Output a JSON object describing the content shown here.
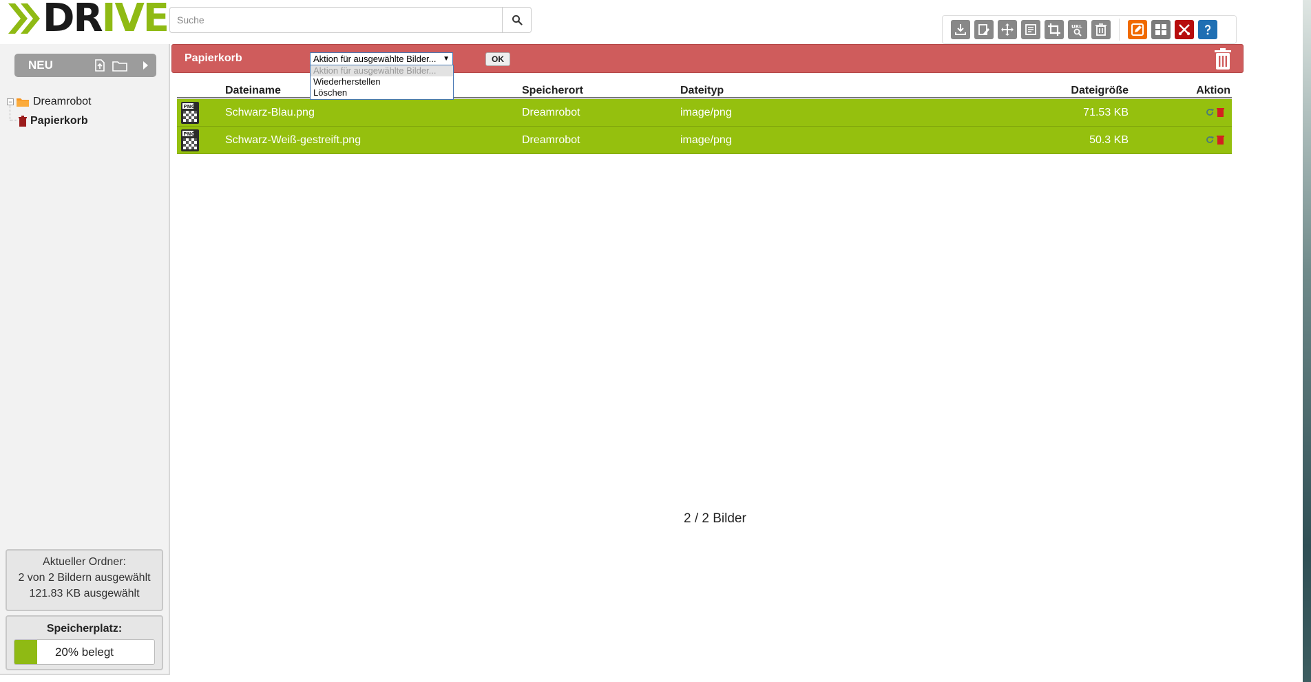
{
  "logo": {
    "part1": "DR",
    "part2": "IVE"
  },
  "search": {
    "placeholder": "Suche"
  },
  "toolbar": {
    "icons": [
      "download-icon",
      "image-edit-icon",
      "move-icon",
      "rename-icon",
      "crop-icon",
      "url-search-icon",
      "trash-icon",
      "edit-mode-icon",
      "grid-view-icon",
      "tools-icon",
      "help-icon"
    ]
  },
  "sidebar": {
    "new_label": "NEU",
    "tree": [
      {
        "label": "Dreamrobot"
      },
      {
        "label": "Papierkorb"
      }
    ],
    "info": {
      "line1": "Aktueller Ordner:",
      "line2": "2 von 2 Bildern ausgewählt",
      "line3": "121.83 KB ausgewählt"
    },
    "storage": {
      "title": "Speicherplatz:",
      "text": "20% belegt",
      "percent": 20
    }
  },
  "trash_bar": {
    "title": "Papierkorb",
    "select_value": "Aktion für ausgewählte Bilder...",
    "ok_label": "OK",
    "options": [
      "Aktion für ausgewählte Bilder...",
      "Wiederherstellen",
      "Löschen"
    ]
  },
  "table": {
    "headers": {
      "name": "Dateiname",
      "location": "Speicherort",
      "type": "Dateityp",
      "size": "Dateigröße",
      "action": "Aktion"
    },
    "rows": [
      {
        "name": "Schwarz-Blau.png",
        "location": "Dreamrobot",
        "type": "image/png",
        "size": "71.53 KB"
      },
      {
        "name": "Schwarz-Weiß-gestreift.png",
        "location": "Dreamrobot",
        "type": "image/png",
        "size": "50.3 KB"
      }
    ]
  },
  "footer": {
    "count": "2 / 2 Bilder"
  },
  "colors": {
    "brand_green": "#8fba14",
    "row_green": "#95c00e",
    "trash_red": "#cf5c5c"
  }
}
